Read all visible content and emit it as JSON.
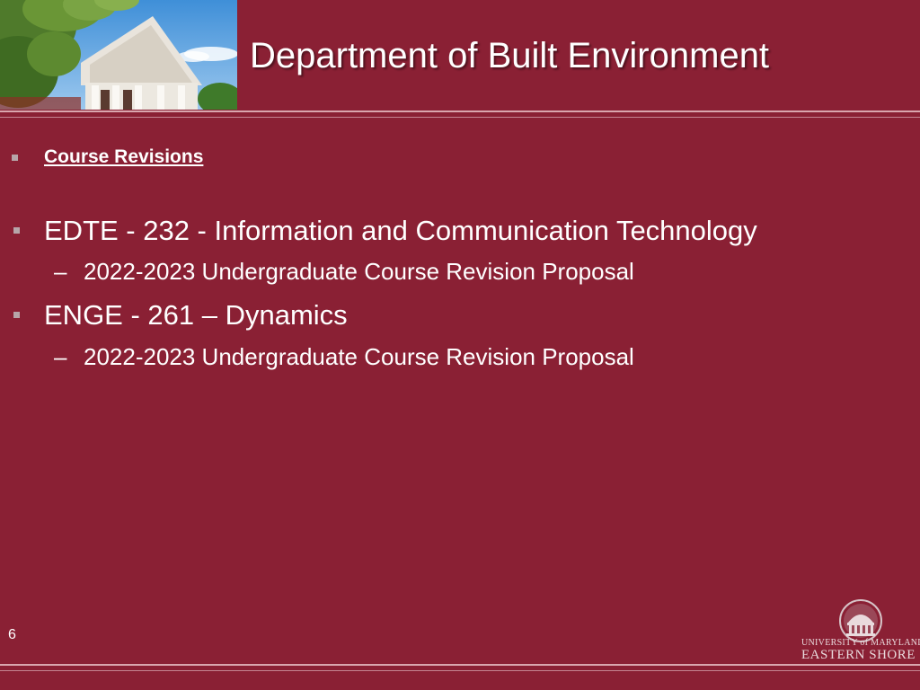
{
  "slide": {
    "title": "Department of Built Environment",
    "section_heading": "Course Revisions",
    "items": [
      {
        "label": "EDTE - 232 - Information and Communication Technology",
        "sub": "2022-2023 Undergraduate Course Revision Proposal"
      },
      {
        "label": "ENGE - 261 – Dynamics",
        "sub": "2022-2023 Undergraduate Course Revision Proposal"
      }
    ],
    "sub_marker": "–",
    "page_number": "6"
  },
  "logo": {
    "line1": "UNIVERSITY of MARYLAND",
    "line2": "EASTERN SHORE",
    "icon": "university-dome-icon"
  },
  "colors": {
    "background": "#8a2034",
    "text": "#ffffff",
    "bullet": "#b7a5a9",
    "rule": "#d9a6ae"
  }
}
